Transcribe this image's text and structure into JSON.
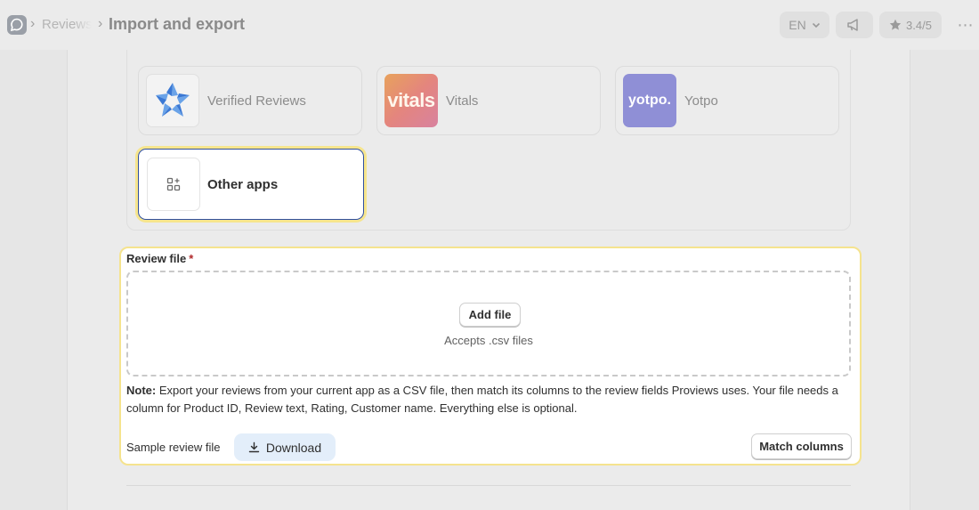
{
  "header": {
    "breadcrumb_parent": "Reviews",
    "page_title": "Import and export",
    "language": "EN",
    "rating": "3.4/5"
  },
  "apps": {
    "tiles": [
      {
        "name": "Verified Reviews",
        "logo_icon": "verified-reviews-star-logo"
      },
      {
        "name": "Vitals",
        "logo_text": "vitals"
      },
      {
        "name": "Yotpo",
        "logo_text": "yotpo."
      }
    ],
    "other": {
      "name": "Other apps",
      "icon": "apps-add-icon"
    }
  },
  "review_file": {
    "label": "Review file",
    "required_mark": "*",
    "add_file_label": "Add file",
    "accepts_text": "Accepts .csv files",
    "note_prefix": "Note:",
    "note_text": "Export your reviews from your current app as a CSV file, then match its columns to the review fields Proviews uses. Your file needs a column for Product ID, Review text, Rating, Customer name. Everything else is optional.",
    "sample_label": "Sample review file",
    "download_label": "Download",
    "match_columns_label": "Match columns"
  },
  "colors": {
    "highlight": "#f5e38e",
    "selected_border": "#2f4f9f",
    "download_bg": "#e3eefa",
    "required": "#b0282a"
  }
}
